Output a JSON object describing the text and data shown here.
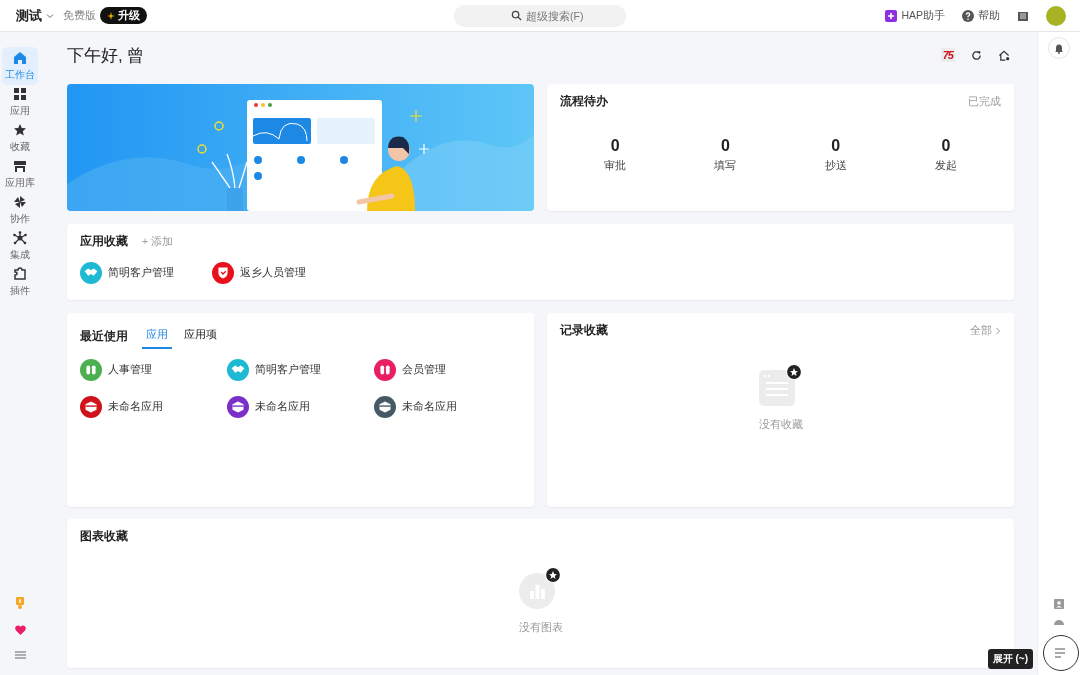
{
  "header": {
    "workspace": "测试",
    "plan": "免费版",
    "upgrade": "升级",
    "search": {
      "placeholder": "超级搜索(F)"
    },
    "assistant": "HAP助手",
    "help": "帮助"
  },
  "sidebar": {
    "items": [
      {
        "label": "工作台",
        "selected": true
      },
      {
        "label": "应用",
        "selected": false
      },
      {
        "label": "收藏",
        "selected": false
      },
      {
        "label": "应用库",
        "selected": false
      },
      {
        "label": "协作",
        "selected": false
      },
      {
        "label": "集成",
        "selected": false
      },
      {
        "label": "插件",
        "selected": false
      }
    ]
  },
  "greeting": "下午好, 曾",
  "badge": "75",
  "workflow": {
    "title": "流程待办",
    "link": "已完成",
    "stats": [
      {
        "count": "0",
        "label": "审批"
      },
      {
        "count": "0",
        "label": "填写"
      },
      {
        "count": "0",
        "label": "抄送"
      },
      {
        "count": "0",
        "label": "发起"
      }
    ]
  },
  "app_favorites": {
    "title": "应用收藏",
    "add": "+ 添加",
    "apps": [
      {
        "name": "简明客户管理",
        "color": "#1eb9d3",
        "kind": "handshake"
      },
      {
        "name": "返乡人员管理",
        "color": "#e8101a",
        "kind": "shield"
      }
    ]
  },
  "recent": {
    "title": "最近使用",
    "tabs": [
      {
        "label": "应用",
        "selected": true
      },
      {
        "label": "应用项",
        "selected": false
      }
    ],
    "apps": [
      {
        "name": "人事管理",
        "color": "#4caf50",
        "kind": "people"
      },
      {
        "name": "简明客户管理",
        "color": "#1eb9d3",
        "kind": "handshake"
      },
      {
        "name": "会员管理",
        "color": "#e91e63",
        "kind": "people"
      },
      {
        "name": "未命名应用",
        "color": "#d0121b",
        "kind": "box"
      },
      {
        "name": "未命名应用",
        "color": "#7b2fc9",
        "kind": "box"
      },
      {
        "name": "未命名应用",
        "color": "#455a64",
        "kind": "box"
      }
    ]
  },
  "record_favorites": {
    "title": "记录收藏",
    "link": "全部",
    "empty": "没有收藏"
  },
  "chart_favorites": {
    "title": "图表收藏",
    "empty": "没有图表"
  },
  "tooltip": "展开 (~)"
}
